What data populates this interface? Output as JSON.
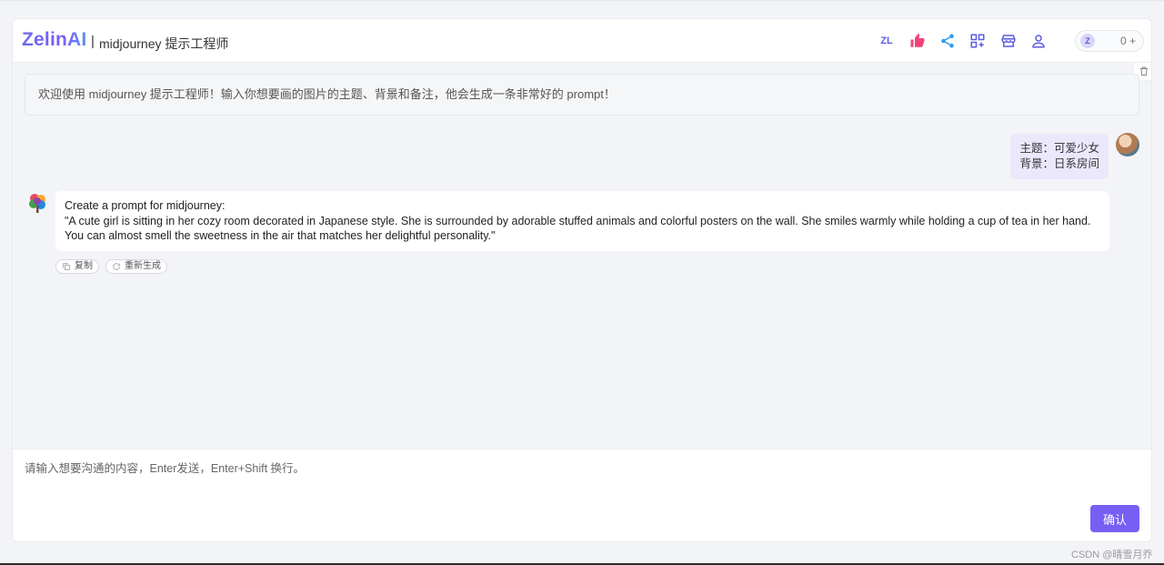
{
  "header": {
    "brand": "ZelinAI",
    "separator": "|",
    "app_title": "midjourney 提示工程师",
    "icons": [
      "zl-logo-icon",
      "thumbs-up-icon",
      "share-icon",
      "apps-icon",
      "store-icon",
      "user-icon"
    ],
    "zl_text": "ZL",
    "credits": {
      "avatar_text": "Z",
      "value": "0 +"
    }
  },
  "welcome_message": "欢迎使用 midjourney 提示工程师！输入你想要画的图片的主题、背景和备注，他会生成一条非常好的 prompt！",
  "user_message": {
    "lines": [
      "主题：可爱少女",
      "背景：日系房间"
    ]
  },
  "bot_message": {
    "lines": [
      "Create a prompt for midjourney:",
      "\"A cute girl is sitting in her cozy room decorated in Japanese style. She is surrounded by adorable stuffed animals and colorful posters on the wall. She smiles warmly while holding a cup of tea in her hand. You can almost smell the sweetness in the air that matches her delightful personality.\""
    ],
    "actions": {
      "copy": "复制",
      "regenerate": "重新生成"
    }
  },
  "composer": {
    "placeholder": "请输入想要沟通的内容，Enter发送，Enter+Shift 换行。",
    "value": "",
    "submit_label": "确认"
  },
  "watermark": "CSDN @晴雪月乔",
  "colors": {
    "accent": "#7660f4",
    "user_bubble": "#ebe8fc",
    "thumb": "#f0437a",
    "share": "#2f9bf0",
    "icon": "#5a5ce0"
  }
}
